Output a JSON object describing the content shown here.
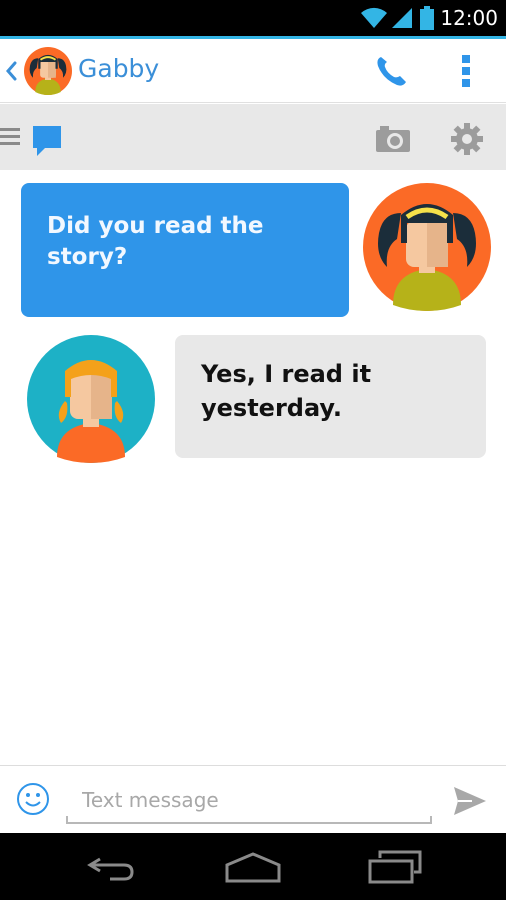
{
  "status_bar": {
    "time": "12:00"
  },
  "header": {
    "contact_name": "Gabby",
    "icons": [
      "back-chevron-icon",
      "phone-icon",
      "overflow-menu-icon"
    ]
  },
  "toolbar": {
    "icons": [
      "menu-icon",
      "compose-message-icon",
      "camera-icon",
      "settings-gear-icon"
    ]
  },
  "messages": [
    {
      "sender": "Gabby",
      "text": "Did you read the story?"
    },
    {
      "sender": "other",
      "text": "Yes, I read it yesterday."
    }
  ],
  "composer": {
    "placeholder": "Text message",
    "icons": [
      "emoji-icon",
      "send-icon"
    ]
  },
  "navigation": {
    "icons": [
      "back-icon",
      "home-icon",
      "recents-icon"
    ]
  },
  "colors": {
    "accent": "#3b8fd8",
    "sent_bubble": "#2f95e9",
    "received_bubble": "#e8e8e8",
    "status_accent": "#33b5e5"
  }
}
